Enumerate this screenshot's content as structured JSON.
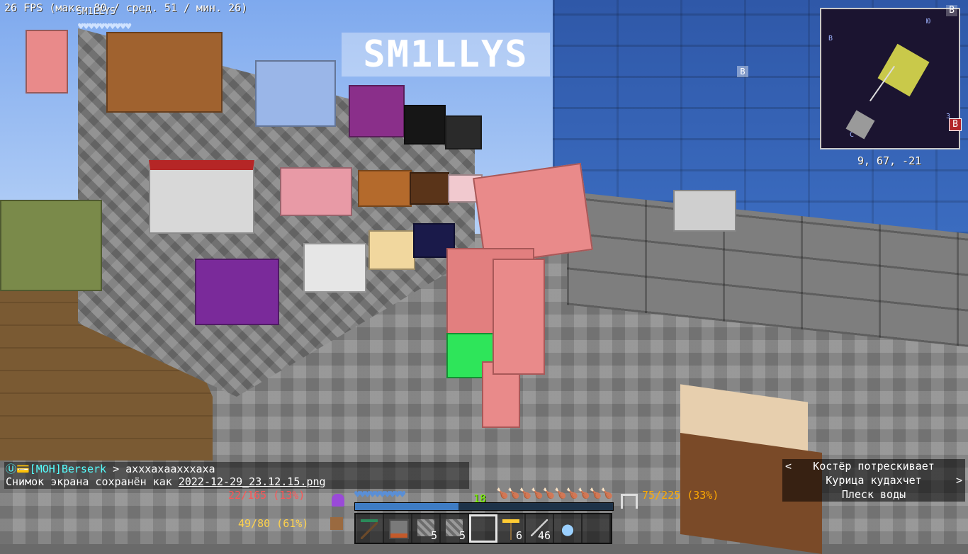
{
  "hud": {
    "fps_text": "26 FPS (макс. 80 / сред. 51 / мин. 26)",
    "player_name": "SM1LLYS",
    "player_hearts": "♥♥♥♥♥♥♥♥♥♥",
    "nameplate": "SM1LLYS",
    "compass_marker": "В"
  },
  "minimap": {
    "top_right_letter": "В",
    "right_letter": "В",
    "north_label": "Ю",
    "west_label": "В",
    "east_label": "З",
    "south_label": "С",
    "coordinates": "9, 67, -21"
  },
  "chat": {
    "line1_prefix": "Ⓤ💳[МОН]Berserk",
    "line1_text": " > ахххахаахххаха",
    "line2_text": "Снимок экрана сохранён как ",
    "line2_link": "2022-12-29_23.12.15.png"
  },
  "subtitles": {
    "items": [
      {
        "text": "Костёр потрескивает",
        "arrow": "left"
      },
      {
        "text": "Курица кудахчет",
        "arrow": "right"
      },
      {
        "text": "Плеск воды",
        "arrow": ""
      }
    ],
    "left_arrow": "<",
    "right_arrow": ">"
  },
  "stats": {
    "health_text": "22/165 (13%)",
    "defense_text": "49/80 (61%)",
    "mana_text": "75/225 (33%)",
    "hearts": "♥♥♥♥♥♥♥♥♥♥",
    "hunger": "🍗🍗🍗🍗🍗🍗🍗🍗🍗🍗",
    "xp_level": "18",
    "xp_progress": 0.4,
    "colors": {
      "health": "#ff5555",
      "defense": "#ffd24c",
      "mana": "#ffaa00",
      "xp": "#7cfc00"
    }
  },
  "hotbar": {
    "selected": 4,
    "slots": [
      {
        "icon": "pickaxe-icon",
        "count": ""
      },
      {
        "icon": "furnace-icon",
        "count": ""
      },
      {
        "icon": "cobblestone-icon",
        "count": "5"
      },
      {
        "icon": "cobblestone-icon",
        "count": "5"
      },
      {
        "icon": "empty-slot",
        "count": ""
      },
      {
        "icon": "torch-icon",
        "count": "6"
      },
      {
        "icon": "arrow-icon",
        "count": "46"
      },
      {
        "icon": "potion-icon",
        "count": ""
      },
      {
        "icon": "empty-slot",
        "count": ""
      }
    ]
  }
}
